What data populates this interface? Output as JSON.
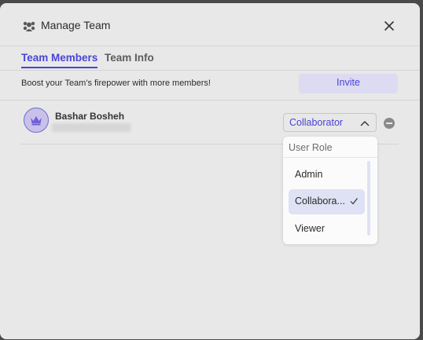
{
  "header": {
    "title": "Manage Team"
  },
  "tabs": [
    {
      "label": "Team Members",
      "active": true
    },
    {
      "label": "Team Info",
      "active": false
    }
  ],
  "invite_bar": {
    "text": "Boost your Team's firepower with more members!",
    "button_label": "Invite"
  },
  "member": {
    "name": "Bashar Bosheh",
    "role": "Collaborator"
  },
  "role_dropdown": {
    "header": "User Role",
    "options": [
      {
        "label": "Admin",
        "selected": false
      },
      {
        "label": "Collabora...",
        "selected": true
      },
      {
        "label": "Viewer",
        "selected": false
      }
    ]
  },
  "colors": {
    "accent": "#4a43d6",
    "modal_bg": "#e8e8e8",
    "invite_bg": "#dddbf2"
  },
  "icons": [
    "team-icon",
    "close-icon",
    "crown-icon",
    "chevron-up-icon",
    "check-icon",
    "remove-icon"
  ]
}
